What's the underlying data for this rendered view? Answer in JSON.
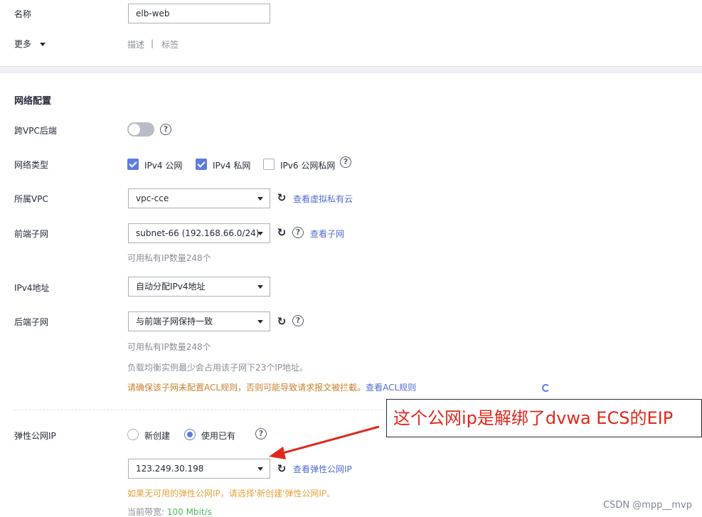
{
  "basic": {
    "name_label": "名称",
    "name_value": "elb-web",
    "more_label": "更多",
    "desc_link": "描述",
    "separator": "|",
    "tag_link": "标签"
  },
  "network": {
    "section_title": "网络配置",
    "cross_vpc_label": "跨VPC后端",
    "cross_vpc_enabled": false,
    "network_type_label": "网络类型",
    "network_types": [
      {
        "label": "IPv4 公网",
        "checked": true
      },
      {
        "label": "IPv4 私网",
        "checked": true
      },
      {
        "label": "IPv6 公网私网",
        "checked": false
      }
    ],
    "vpc_label": "所属VPC",
    "vpc_value": "vpc-cce",
    "vpc_link": "查看虚拟私有云",
    "frontend_subnet_label": "前端子网",
    "frontend_subnet_value": "subnet-66 (192.168.66.0/24)",
    "frontend_subnet_link": "查看子网",
    "frontend_available_ip": "可用私有IP数量248个",
    "ipv4_address_label": "IPv4地址",
    "ipv4_address_value": "自动分配IPv4地址",
    "backend_subnet_label": "后端子网",
    "backend_subnet_value": "与前端子网保持一致",
    "backend_available_ip": "可用私有IP数量248个",
    "backend_ip_usage": "负载均衡实例最少会占用该子网下23个IP地址。",
    "acl_warning": "请确保该子网未配置ACL规则，否则可能导致请求报文被拦截。",
    "acl_link": "查看ACL规则"
  },
  "eip": {
    "label": "弹性公网IP",
    "option_new": "新创建",
    "option_existing": "使用已有",
    "selected_option": "使用已有",
    "selected_ip": "123.249.30.198",
    "eip_link": "查看弹性公网IP",
    "no_eip_hint": "如果无可用的弹性公网IP，请选择'新创建'弹性公网IP。",
    "bandwidth_label": "当前带宽:",
    "bandwidth_value": "100 Mbit/s"
  },
  "annotation": {
    "text": "这个公网ip是解绑了dvwa ECS的EIP",
    "color": "#e0281c"
  },
  "watermark": "CSDN @mpp__mvp",
  "colors": {
    "accent": "#5e7ce0",
    "link": "#526ecc",
    "warning": "#e6a23c",
    "hint": "#8a8e99"
  }
}
